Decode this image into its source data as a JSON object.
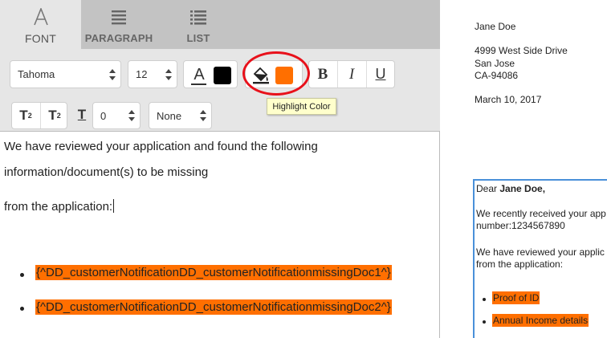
{
  "tabs": [
    {
      "label": "FONT",
      "icon": "font-a-icon",
      "active": true
    },
    {
      "label": "PARAGRAPH",
      "icon": "paragraph-lines-icon",
      "active": false
    },
    {
      "label": "LIST",
      "icon": "list-icon",
      "active": false
    }
  ],
  "toolbar": {
    "font_family": "Tahoma",
    "font_size": "12",
    "text_color": "#000000",
    "highlight_color": "#ff6f00",
    "bold_label": "B",
    "italic_label": "I",
    "underline_label": "U",
    "superscript_label": "T",
    "superscript_mark": "2",
    "subscript_label": "T",
    "subscript_mark": "2",
    "spacing_value": "0",
    "style_value": "None"
  },
  "tooltip": "Highlight Color",
  "editor": {
    "line1": "We have reviewed your application and found the following",
    "line2": "information/document(s) to be missing",
    "line3": "from the application:",
    "items": [
      "{^DD_customerNotificationDD_customerNotificationmissingDoc1^}",
      "{^DD_customerNotificationDD_customerNotificationmissingDoc2^}"
    ]
  },
  "preview": {
    "name": "Jane Doe",
    "address1": "4999 West Side Drive",
    "city": "San Jose",
    "state_zip": "CA-94086",
    "date": "March 10, 2017",
    "greeting_prefix": "Dear ",
    "greeting_name": "Jane Doe,",
    "p1_line1": "We recently received your app",
    "p1_line2": "number:1234567890",
    "p2_line1": "We have reviewed your applic",
    "p2_line2": "from the application:",
    "items": [
      "Proof of ID",
      "Annual Income details"
    ]
  },
  "colors": {
    "accent_highlight": "#ff6f00",
    "circle_annotation": "#e8111b",
    "tooltip_bg": "#ffffcc"
  }
}
